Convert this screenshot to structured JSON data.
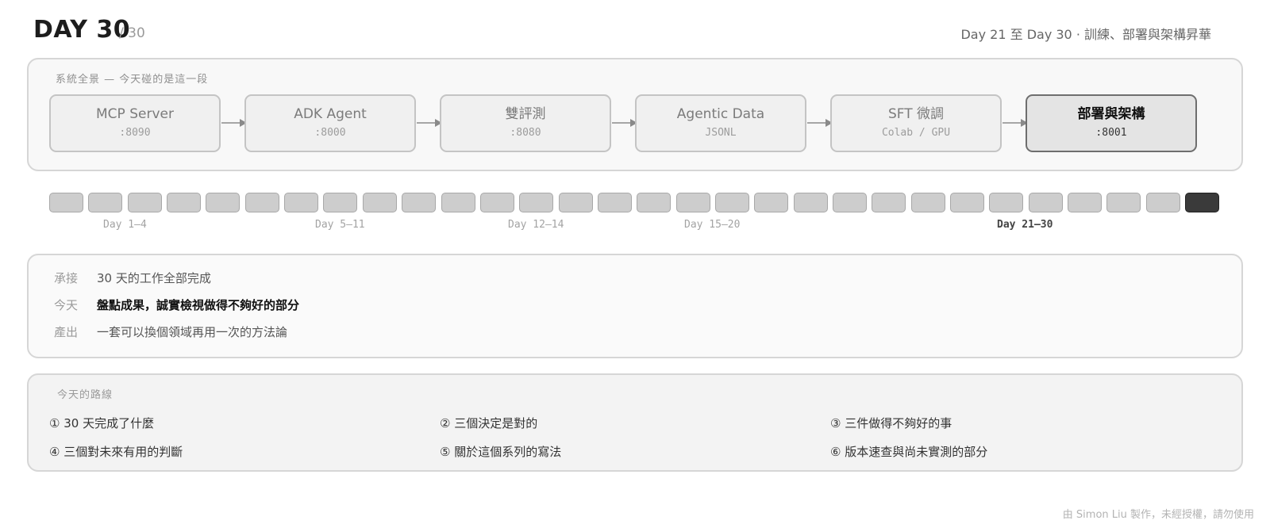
{
  "header": {
    "day_title": "DAY 30",
    "day_total": "/ 30",
    "phase_desc": "Day 21 至 Day 30 · 訓練、部署與架構昇華"
  },
  "system": {
    "label": "系統全景 — 今天碰的是這一段",
    "stages": [
      {
        "name": "MCP Server",
        "sub": ":8090",
        "active": false
      },
      {
        "name": "ADK Agent",
        "sub": ":8000",
        "active": false
      },
      {
        "name": "雙評測",
        "sub": ":8080",
        "active": false
      },
      {
        "name": "Agentic Data",
        "sub": "JSONL",
        "active": false
      },
      {
        "name": "SFT 微調",
        "sub": "Colab / GPU",
        "active": false
      },
      {
        "name": "部署與架構",
        "sub": ":8001",
        "active": true
      }
    ]
  },
  "timeline": {
    "total_days": 30,
    "current_day": 30,
    "labels": [
      {
        "text": "Day 1–4",
        "active": false
      },
      {
        "text": "Day 5–11",
        "active": false
      },
      {
        "text": "Day 12–14",
        "active": false
      },
      {
        "text": "Day 15–20",
        "active": false
      },
      {
        "text": "Day 21–30",
        "active": true
      }
    ]
  },
  "context": {
    "rows": [
      {
        "key": "承接",
        "value": "30 天的工作全部完成",
        "bold": false
      },
      {
        "key": "今天",
        "value": "盤點成果，誠實檢視做得不夠好的部分",
        "bold": true
      },
      {
        "key": "產出",
        "value": "一套可以換個領域再用一次的方法論",
        "bold": false
      }
    ]
  },
  "route": {
    "label": "今天的路線",
    "items": [
      "① 30 天完成了什麼",
      "② 三個決定是對的",
      "③ 三件做得不夠好的事",
      "④ 三個對未來有用的判斷",
      "⑤ 關於這個系列的寫法",
      "⑥ 版本速查與尚未實測的部分"
    ]
  },
  "footer": "由 Simon Liu 製作，未經授權，請勿使用",
  "colors": {
    "active_stage_border": "#6e6e6e",
    "active_day": "#3a3a3a",
    "inactive_day": "#cdcdcd"
  }
}
